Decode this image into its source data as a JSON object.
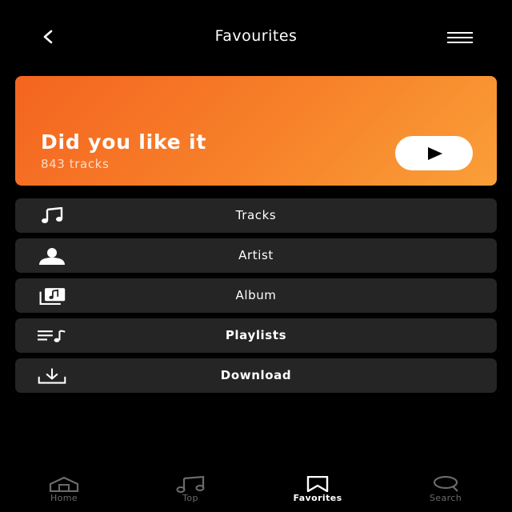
{
  "header": {
    "title": "Favourites",
    "back_icon": "chevron-left-icon",
    "menu_icon": "hamburger-menu-icon"
  },
  "hero": {
    "title": "Did you like it",
    "subtitle": "843 tracks",
    "play_icon": "play-icon",
    "gradient_start": "#f46420",
    "gradient_end": "#fa9f38"
  },
  "list": [
    {
      "label": "Tracks",
      "icon": "music-note-icon",
      "bold": false
    },
    {
      "label": "Artist",
      "icon": "person-icon",
      "bold": false
    },
    {
      "label": "Album",
      "icon": "album-icon",
      "bold": false
    },
    {
      "label": "Playlists",
      "icon": "playlist-icon",
      "bold": true
    },
    {
      "label": "Download",
      "icon": "download-icon",
      "bold": true
    }
  ],
  "bottom_nav": {
    "items": [
      {
        "label": "Home",
        "icon": "home-icon",
        "active": false
      },
      {
        "label": "Top",
        "icon": "music-note-icon",
        "active": false
      },
      {
        "label": "Favorites",
        "icon": "bookmark-icon",
        "active": true
      },
      {
        "label": "Search",
        "icon": "search-icon",
        "active": false
      }
    ]
  },
  "colors": {
    "background": "#000000",
    "card": "#252525",
    "accent": "#f7822a",
    "inactive": "#6b6b6b"
  }
}
